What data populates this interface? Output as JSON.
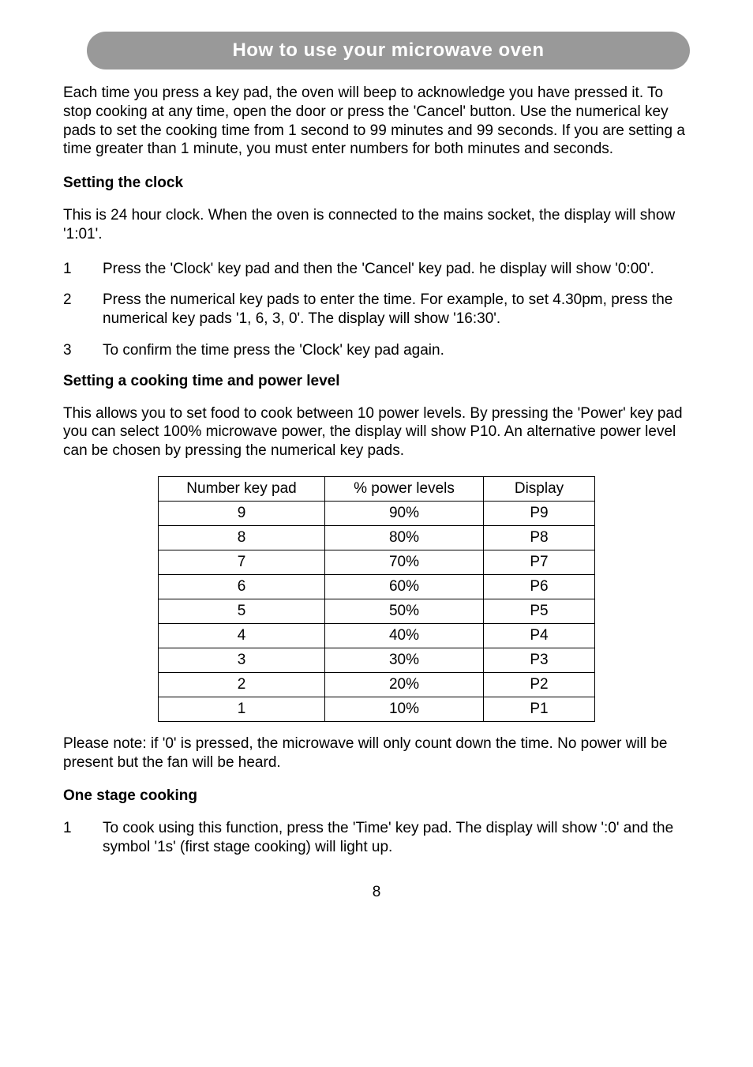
{
  "banner": {
    "title": "How to use your microwave oven"
  },
  "intro": "Each time you press a key pad, the oven will beep to acknowledge you have pressed it. To stop cooking at any time, open the door or press the 'Cancel' button. Use the numerical key pads to set the cooking time from 1 second to 99 minutes and 99 seconds. If you are setting a time greater than 1 minute, you must enter numbers for both minutes and seconds.",
  "section1": {
    "heading": "Setting the clock",
    "para": "This is 24 hour clock. When the oven is connected to the mains socket, the display will show '1:01'.",
    "items": [
      {
        "n": "1",
        "t": "Press the 'Clock' key pad and then the 'Cancel' key pad.  he display will show '0:00'."
      },
      {
        "n": "2",
        "t": "Press the numerical key pads to enter the time. For example, to set 4.30pm, press the numerical key pads '1, 6, 3, 0'. The display will show '16:30'."
      },
      {
        "n": "3",
        "t": "To confirm the time press the 'Clock' key pad again."
      }
    ]
  },
  "section2": {
    "heading": "Setting a cooking time and power level",
    "para": "This allows you to set food to cook between 10 power levels. By pressing the 'Power' key pad you can select 100% microwave power, the display will show P10. An alternative power level can be chosen by pressing the numerical key pads.",
    "table_headers": {
      "a": "Number key pad",
      "b": "% power levels",
      "c": "Display"
    },
    "rows": [
      {
        "a": "9",
        "b": "90%",
        "c": "P9"
      },
      {
        "a": "8",
        "b": "80%",
        "c": "P8"
      },
      {
        "a": "7",
        "b": "70%",
        "c": "P7"
      },
      {
        "a": "6",
        "b": "60%",
        "c": "P6"
      },
      {
        "a": "5",
        "b": "50%",
        "c": "P5"
      },
      {
        "a": "4",
        "b": "40%",
        "c": "P4"
      },
      {
        "a": "3",
        "b": "30%",
        "c": "P3"
      },
      {
        "a": "2",
        "b": "20%",
        "c": "P2"
      },
      {
        "a": "1",
        "b": "10%",
        "c": "P1"
      }
    ],
    "note": "Please note: if '0' is pressed, the microwave will only count down the time. No power will be present but the fan will be heard."
  },
  "section3": {
    "heading": "One stage cooking",
    "items": [
      {
        "n": "1",
        "t": "To cook using this function, press the 'Time' key pad. The display will show ':0' and the symbol '1s' (first stage cooking) will light up."
      }
    ]
  },
  "page_number": "8"
}
